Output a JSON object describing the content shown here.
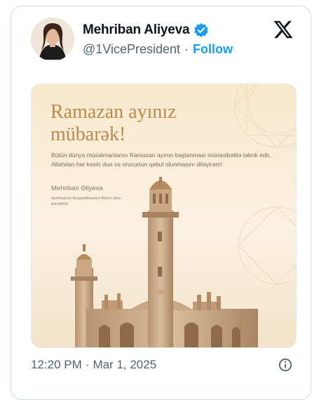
{
  "author": {
    "name": "Mehriban Aliyeva",
    "handle": "@1VicePresident",
    "separator": "·",
    "follow_label": "Follow",
    "avatar_icon": "profile-photo",
    "verified_icon": "verified-badge-icon"
  },
  "brand": {
    "icon": "x-logo-icon"
  },
  "post_image": {
    "title": "Ramazan ayınız\nmübarək!",
    "body": "Bütün dünya müsəlmanlarını Ramazan ayının başlanması münasibətilə təbrik edir, Allahdan hər kəsin dua və orucunun qəbul olunmasını diləyirəm!",
    "signature": "Mehriban Əliyeva",
    "role": "Azərbaycan Respublikasının Birinci vitse-prezidenti"
  },
  "meta": {
    "time": "12:20 PM",
    "dot": "·",
    "date": "Mar 1, 2025",
    "info_icon": "info-icon"
  },
  "colors": {
    "accent": "#1d9bf0",
    "text": "#0f1419",
    "muted": "#536471",
    "poster_gold": "#b88a4e"
  }
}
